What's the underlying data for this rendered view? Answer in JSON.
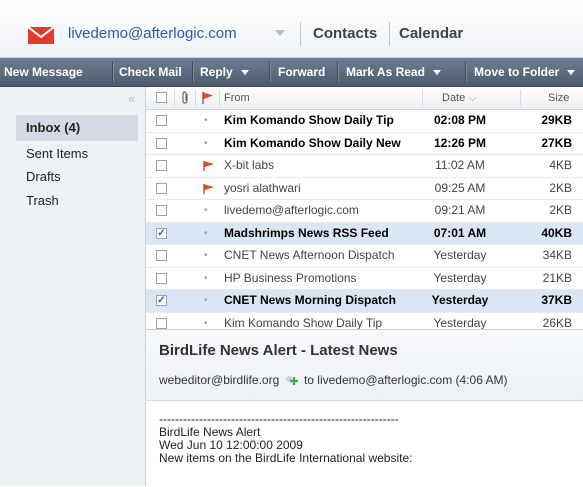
{
  "header": {
    "account": "livedemo@afterlogic.com",
    "contacts": "Contacts",
    "calendar": "Calendar",
    "icons": [
      "mail-icon",
      "chevron-down-icon"
    ]
  },
  "toolbar": {
    "new_message": "New Message",
    "check_mail": "Check Mail",
    "reply": "Reply",
    "forward": "Forward",
    "mark_as_read": "Mark As Read",
    "move_to_folder": "Move to Folder"
  },
  "sidebar": {
    "folders": [
      {
        "label": "Inbox (4)",
        "active": true
      },
      {
        "label": "Sent Items",
        "active": false
      },
      {
        "label": "Drafts",
        "active": false
      },
      {
        "label": "Trash",
        "active": false
      }
    ]
  },
  "list": {
    "columns": {
      "from": "From",
      "date": "Date",
      "size": "Size"
    },
    "rows": [
      {
        "from": "Kim Komando Show Daily Tip",
        "date": "02:08 PM",
        "size": "29KB",
        "unread": true,
        "flagged": false,
        "checked": false
      },
      {
        "from": "Kim Komando Show Daily New",
        "date": "12:26 PM",
        "size": "27KB",
        "unread": true,
        "flagged": false,
        "checked": false
      },
      {
        "from": "X-bit labs",
        "date": "11:02 AM",
        "size": "4KB",
        "unread": false,
        "flagged": true,
        "checked": false
      },
      {
        "from": "yosri alathwari",
        "date": "09:25 AM",
        "size": "2KB",
        "unread": false,
        "flagged": true,
        "checked": false
      },
      {
        "from": "livedemo@afterlogic.com",
        "date": "09:21 AM",
        "size": "2KB",
        "unread": false,
        "flagged": false,
        "checked": false
      },
      {
        "from": "Madshrimps News RSS Feed",
        "date": "07:01 AM",
        "size": "40KB",
        "unread": true,
        "flagged": false,
        "checked": true
      },
      {
        "from": "CNET News Afternoon Dispatch",
        "date": "Yesterday",
        "size": "34KB",
        "unread": false,
        "flagged": false,
        "checked": false
      },
      {
        "from": "HP Business Promotions",
        "date": "Yesterday",
        "size": "21KB",
        "unread": false,
        "flagged": false,
        "checked": false
      },
      {
        "from": "CNET News Morning Dispatch",
        "date": "Yesterday",
        "size": "37KB",
        "unread": true,
        "flagged": false,
        "checked": true
      },
      {
        "from": "Kim Komando Show Daily Tip",
        "date": "Yesterday",
        "size": "26KB",
        "unread": false,
        "flagged": false,
        "checked": false
      }
    ]
  },
  "preview": {
    "subject": "BirdLife News Alert - Latest News",
    "from": "webeditor@birdlife.org",
    "to_label": "to",
    "to": "livedemo@afterlogic.com (4:06 AM)",
    "body_separator": "------------------------------------------------------------",
    "body_lines": [
      "BirdLife News Alert",
      "Wed Jun 10 12:00:00 2009",
      "New items on the BirdLife International website:"
    ]
  },
  "colors": {
    "accent": "#2a5aa6",
    "toolbar": "#55637a",
    "flag": "#e8471b",
    "selected_row": "#dbe6f4"
  }
}
